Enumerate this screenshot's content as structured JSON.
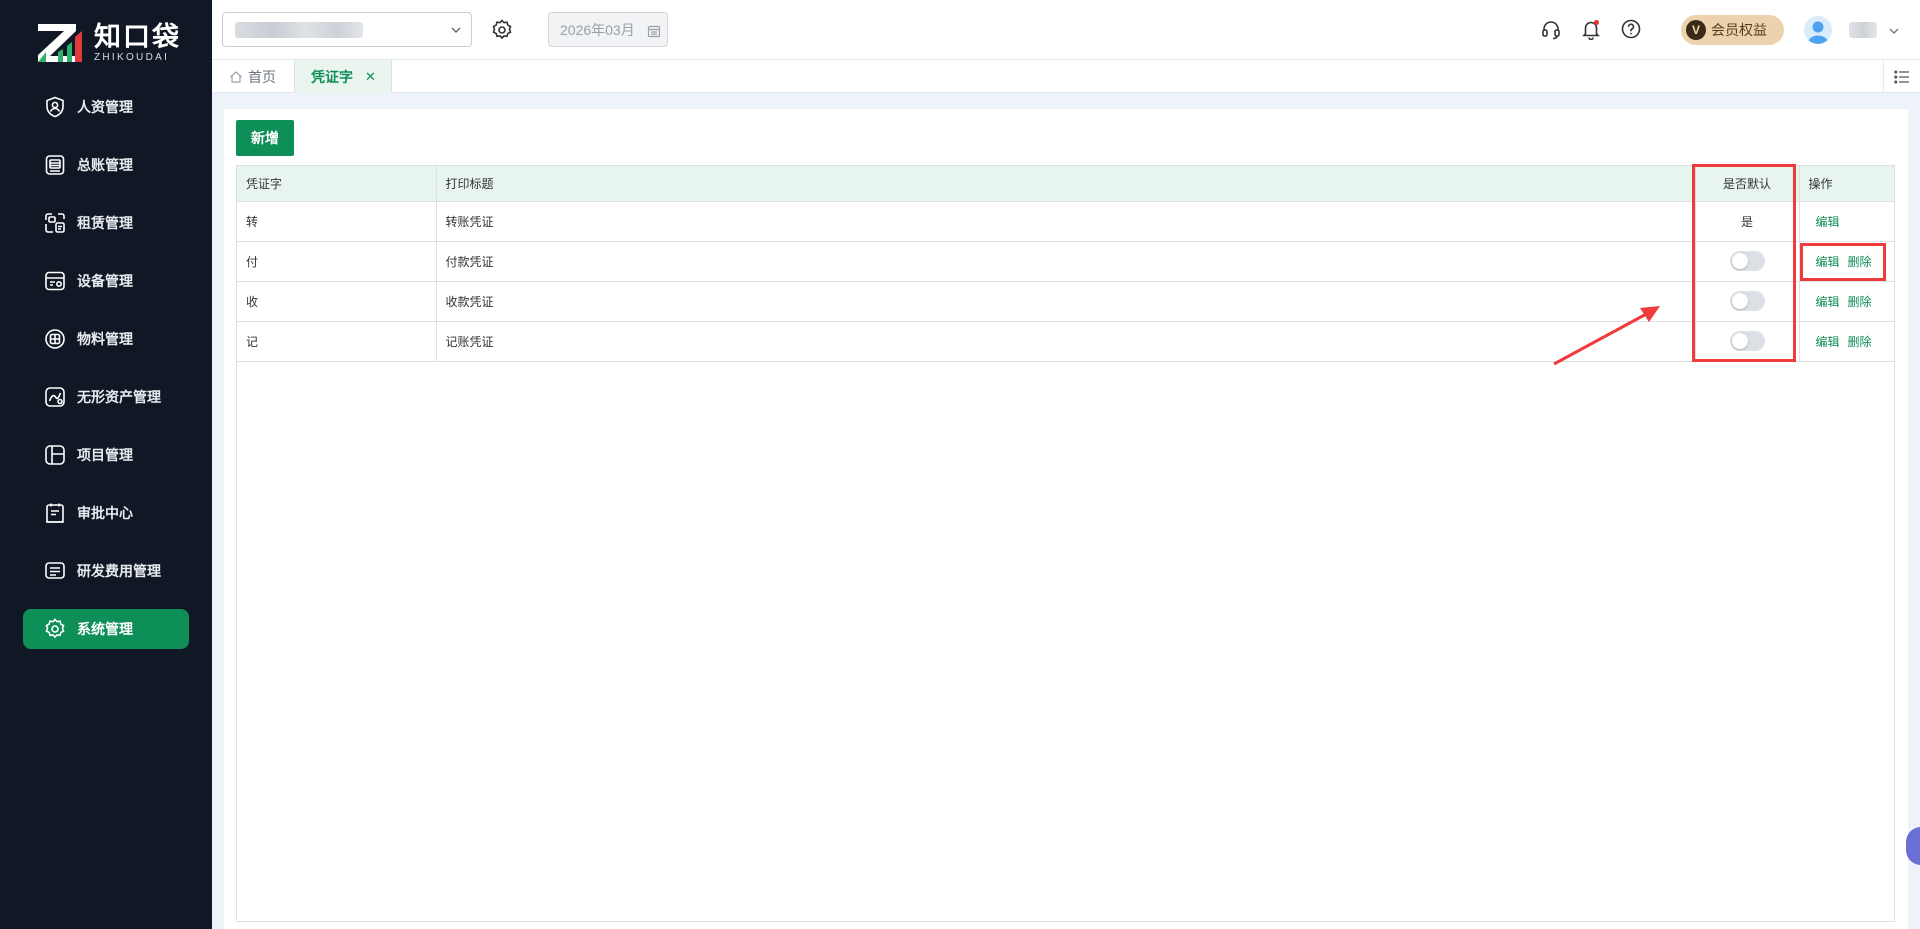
{
  "app": {
    "logo_cn": "知口袋",
    "logo_en": "ZHIKOUDAI"
  },
  "sidebar": {
    "items": [
      {
        "label": "人资管理",
        "icon": "user-shield-icon",
        "active": false
      },
      {
        "label": "总账管理",
        "icon": "ledger-icon",
        "active": false
      },
      {
        "label": "租赁管理",
        "icon": "lease-icon",
        "active": false
      },
      {
        "label": "设备管理",
        "icon": "device-icon",
        "active": false
      },
      {
        "label": "物料管理",
        "icon": "material-icon",
        "active": false
      },
      {
        "label": "无形资产管理",
        "icon": "intangible-asset-icon",
        "active": false
      },
      {
        "label": "项目管理",
        "icon": "project-icon",
        "active": false
      },
      {
        "label": "审批中心",
        "icon": "approval-icon",
        "active": false
      },
      {
        "label": "研发费用管理",
        "icon": "rd-expense-icon",
        "active": false
      },
      {
        "label": "系统管理",
        "icon": "gear-icon",
        "active": true
      }
    ]
  },
  "header": {
    "date_value": "2026年03月",
    "member_label": "会员权益",
    "member_badge_letter": "V"
  },
  "tabs": {
    "home_label": "首页",
    "active_label": "凭证字",
    "close_glyph": "✕"
  },
  "main": {
    "add_button": "新增",
    "table": {
      "headers": [
        "凭证字",
        "打印标题",
        "是否默认",
        "操作"
      ],
      "rows": [
        {
          "word": "转",
          "title": "转账凭证",
          "default_text": "是",
          "is_default": true,
          "actions": [
            "编辑"
          ]
        },
        {
          "word": "付",
          "title": "付款凭证",
          "default_text": "",
          "is_default": false,
          "actions": [
            "编辑",
            "删除"
          ]
        },
        {
          "word": "收",
          "title": "收款凭证",
          "default_text": "",
          "is_default": false,
          "actions": [
            "编辑",
            "删除"
          ]
        },
        {
          "word": "记",
          "title": "记账凭证",
          "default_text": "",
          "is_default": false,
          "actions": [
            "编辑",
            "删除"
          ]
        }
      ]
    }
  },
  "colors": {
    "brand_green": "#0e8f58",
    "sidebar_bg": "#0f1824",
    "annotation_red": "#ef3b3b",
    "member_gold": "#ecd3ad"
  }
}
